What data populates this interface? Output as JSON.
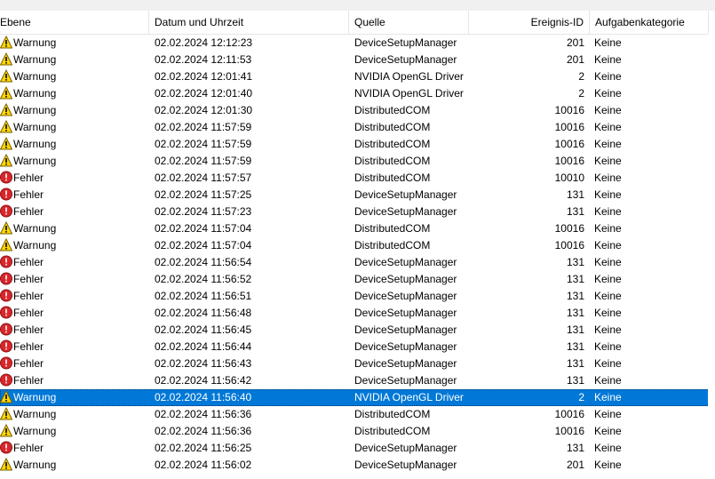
{
  "columns": {
    "level": "Ebene",
    "datetime": "Datum und Uhrzeit",
    "source": "Quelle",
    "event_id": "Ereignis-ID",
    "category": "Aufgabenkategorie"
  },
  "selected_index": 21,
  "rows": [
    {
      "type": "warning",
      "level": "Warnung",
      "datetime": "02.02.2024 12:12:23",
      "source": "DeviceSetupManager",
      "event_id": "201",
      "category": "Keine"
    },
    {
      "type": "warning",
      "level": "Warnung",
      "datetime": "02.02.2024 12:11:53",
      "source": "DeviceSetupManager",
      "event_id": "201",
      "category": "Keine"
    },
    {
      "type": "warning",
      "level": "Warnung",
      "datetime": "02.02.2024 12:01:41",
      "source": "NVIDIA OpenGL Driver",
      "event_id": "2",
      "category": "Keine"
    },
    {
      "type": "warning",
      "level": "Warnung",
      "datetime": "02.02.2024 12:01:40",
      "source": "NVIDIA OpenGL Driver",
      "event_id": "2",
      "category": "Keine"
    },
    {
      "type": "warning",
      "level": "Warnung",
      "datetime": "02.02.2024 12:01:30",
      "source": "DistributedCOM",
      "event_id": "10016",
      "category": "Keine"
    },
    {
      "type": "warning",
      "level": "Warnung",
      "datetime": "02.02.2024 11:57:59",
      "source": "DistributedCOM",
      "event_id": "10016",
      "category": "Keine"
    },
    {
      "type": "warning",
      "level": "Warnung",
      "datetime": "02.02.2024 11:57:59",
      "source": "DistributedCOM",
      "event_id": "10016",
      "category": "Keine"
    },
    {
      "type": "warning",
      "level": "Warnung",
      "datetime": "02.02.2024 11:57:59",
      "source": "DistributedCOM",
      "event_id": "10016",
      "category": "Keine"
    },
    {
      "type": "error",
      "level": "Fehler",
      "datetime": "02.02.2024 11:57:57",
      "source": "DistributedCOM",
      "event_id": "10010",
      "category": "Keine"
    },
    {
      "type": "error",
      "level": "Fehler",
      "datetime": "02.02.2024 11:57:25",
      "source": "DeviceSetupManager",
      "event_id": "131",
      "category": "Keine"
    },
    {
      "type": "error",
      "level": "Fehler",
      "datetime": "02.02.2024 11:57:23",
      "source": "DeviceSetupManager",
      "event_id": "131",
      "category": "Keine"
    },
    {
      "type": "warning",
      "level": "Warnung",
      "datetime": "02.02.2024 11:57:04",
      "source": "DistributedCOM",
      "event_id": "10016",
      "category": "Keine"
    },
    {
      "type": "warning",
      "level": "Warnung",
      "datetime": "02.02.2024 11:57:04",
      "source": "DistributedCOM",
      "event_id": "10016",
      "category": "Keine"
    },
    {
      "type": "error",
      "level": "Fehler",
      "datetime": "02.02.2024 11:56:54",
      "source": "DeviceSetupManager",
      "event_id": "131",
      "category": "Keine"
    },
    {
      "type": "error",
      "level": "Fehler",
      "datetime": "02.02.2024 11:56:52",
      "source": "DeviceSetupManager",
      "event_id": "131",
      "category": "Keine"
    },
    {
      "type": "error",
      "level": "Fehler",
      "datetime": "02.02.2024 11:56:51",
      "source": "DeviceSetupManager",
      "event_id": "131",
      "category": "Keine"
    },
    {
      "type": "error",
      "level": "Fehler",
      "datetime": "02.02.2024 11:56:48",
      "source": "DeviceSetupManager",
      "event_id": "131",
      "category": "Keine"
    },
    {
      "type": "error",
      "level": "Fehler",
      "datetime": "02.02.2024 11:56:45",
      "source": "DeviceSetupManager",
      "event_id": "131",
      "category": "Keine"
    },
    {
      "type": "error",
      "level": "Fehler",
      "datetime": "02.02.2024 11:56:44",
      "source": "DeviceSetupManager",
      "event_id": "131",
      "category": "Keine"
    },
    {
      "type": "error",
      "level": "Fehler",
      "datetime": "02.02.2024 11:56:43",
      "source": "DeviceSetupManager",
      "event_id": "131",
      "category": "Keine"
    },
    {
      "type": "error",
      "level": "Fehler",
      "datetime": "02.02.2024 11:56:42",
      "source": "DeviceSetupManager",
      "event_id": "131",
      "category": "Keine"
    },
    {
      "type": "warning",
      "level": "Warnung",
      "datetime": "02.02.2024 11:56:40",
      "source": "NVIDIA OpenGL Driver",
      "event_id": "2",
      "category": "Keine"
    },
    {
      "type": "warning",
      "level": "Warnung",
      "datetime": "02.02.2024 11:56:36",
      "source": "DistributedCOM",
      "event_id": "10016",
      "category": "Keine"
    },
    {
      "type": "warning",
      "level": "Warnung",
      "datetime": "02.02.2024 11:56:36",
      "source": "DistributedCOM",
      "event_id": "10016",
      "category": "Keine"
    },
    {
      "type": "error",
      "level": "Fehler",
      "datetime": "02.02.2024 11:56:25",
      "source": "DeviceSetupManager",
      "event_id": "131",
      "category": "Keine"
    },
    {
      "type": "warning",
      "level": "Warnung",
      "datetime": "02.02.2024 11:56:02",
      "source": "DeviceSetupManager",
      "event_id": "201",
      "category": "Keine"
    }
  ],
  "colors": {
    "selection": "#0078d7",
    "warning_fill": "#ffd700",
    "error_fill": "#d9262b"
  }
}
